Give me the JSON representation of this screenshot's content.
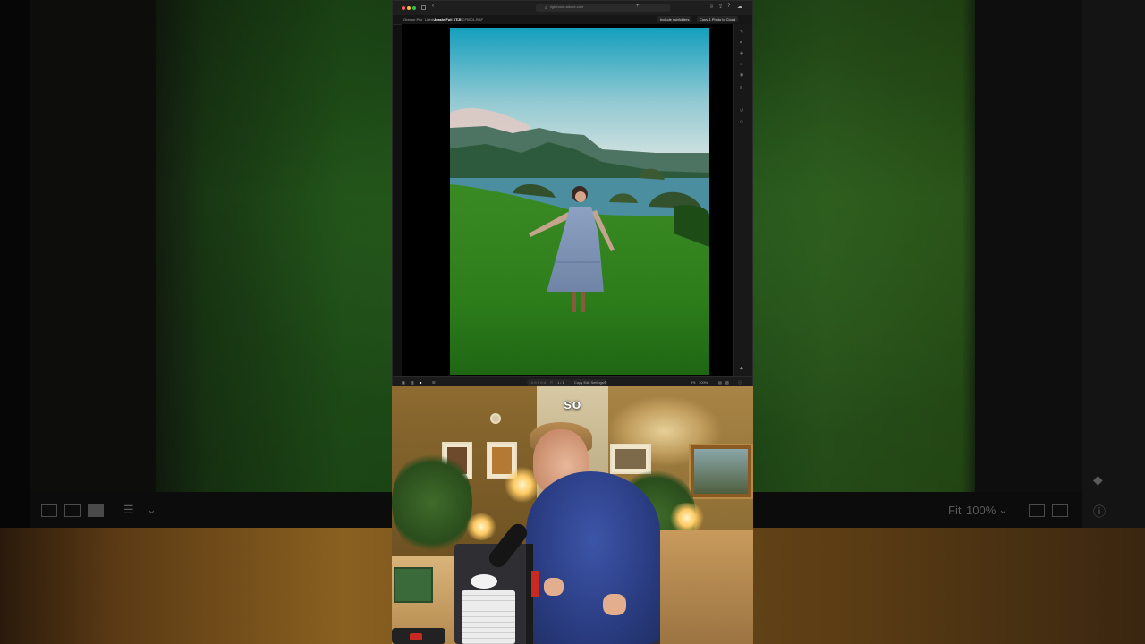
{
  "caption": "so",
  "app": {
    "address_bar": "lightroom.adobe.com",
    "breadcrumb": [
      "Oregon Pro",
      "Lightroom",
      "Jessie Fuji XT-5",
      "DSCF0001.RAF"
    ],
    "toolbar_right": {
      "subtitle_toggle": "Include subfolders",
      "sync_button": "Copy 1 Photo to Cloud"
    },
    "bottom": {
      "rating_text": "☆☆☆☆☆",
      "flag_text": "⚐",
      "count_text": "1 / 1",
      "copy_edit_button": "Copy Edit Settings",
      "fit_label": "Fit",
      "zoom_value": "100%"
    }
  },
  "background_toolbar": {
    "fit_label": "Fit",
    "zoom_value": "100%"
  },
  "colors": {
    "sky_top": "#17a8c4",
    "sky_bottom": "#d9e6e4",
    "grass": "#2f8c1e",
    "water": "#4a90a3",
    "hoodie": "#2c3f86",
    "app_bg": "#111111"
  },
  "icons": [
    "close-dot",
    "minimize-dot",
    "zoom-dot",
    "search-icon",
    "share-icon",
    "cloud-icon",
    "grid-icon",
    "filmstrip-icon",
    "single-view-icon",
    "sort-icon",
    "compare-icon",
    "info-icon",
    "tag-icon"
  ]
}
